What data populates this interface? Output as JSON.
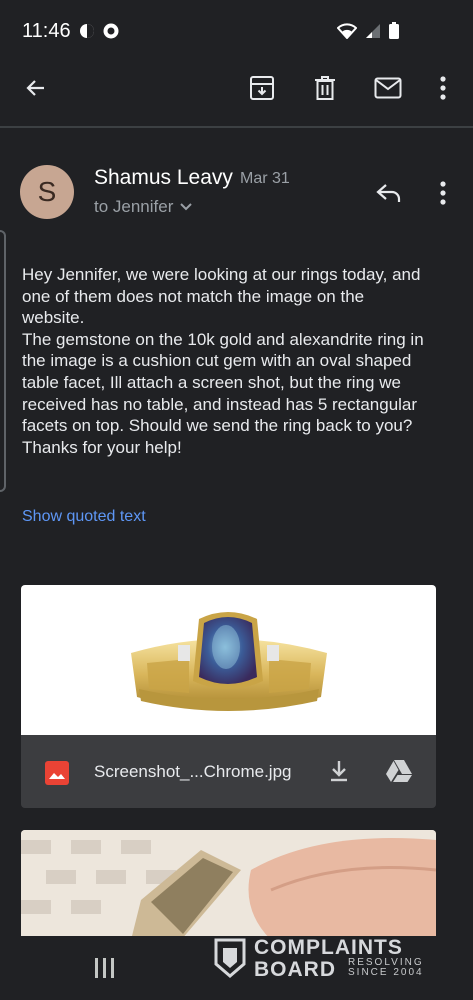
{
  "status": {
    "time": "11:46"
  },
  "toolbar": {
    "back_icon": "arrow-left-icon",
    "archive_icon": "archive-icon",
    "delete_icon": "trash-icon",
    "mark_unread_icon": "mail-icon",
    "more_icon": "more-vert-icon"
  },
  "message": {
    "avatar_letter": "S",
    "sender": "Shamus Leavy",
    "date": "Mar 31",
    "recipient": "to Jennifer",
    "body_lines": [
      "Hey Jennifer, we were looking at our rings today, and",
      "one of them does not match the image on the",
      "website.",
      "The gemstone on the 10k gold and alexandrite ring in",
      "the image is a cushion cut gem with an oval shaped",
      "table facet, Ill attach a screen shot, but the ring we",
      "received has no table, and instead has 5 rectangular",
      "facets on top. Should we send the ring back to you?",
      "Thanks for your help!"
    ],
    "show_quoted": "Show quoted text"
  },
  "attachment": {
    "file_name": "Screenshot_...Chrome.jpg"
  },
  "watermark": {
    "line1": "COMPLAINTS",
    "line2": "BOARD",
    "line3": "RESOLVING",
    "line4": "SINCE 2004"
  },
  "colors": {
    "background": "#202124",
    "link": "#5e97f6",
    "avatar": "#c7a692"
  }
}
